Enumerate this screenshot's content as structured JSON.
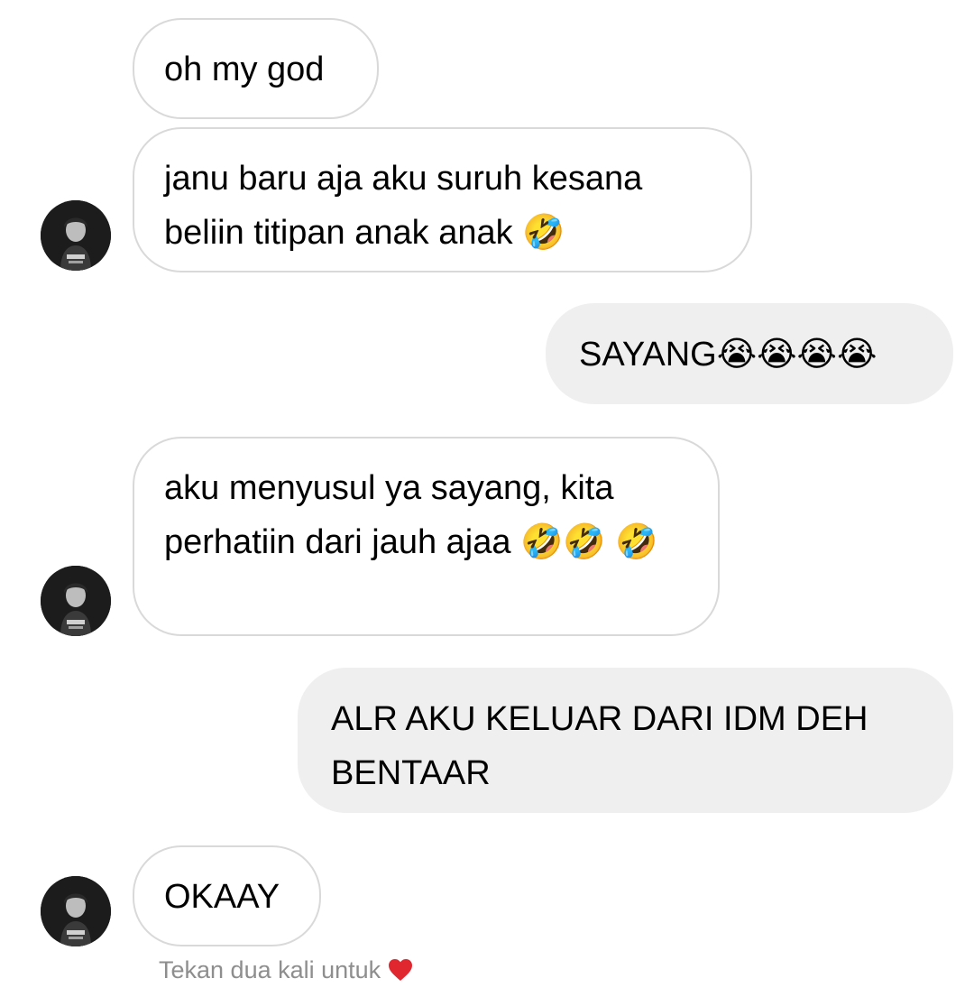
{
  "conversation": {
    "messages": [
      {
        "direction": "incoming",
        "text": "oh my god"
      },
      {
        "direction": "incoming",
        "text": "janu baru aja aku suruh kesana beliin titipan anak anak 🤣"
      },
      {
        "direction": "outgoing",
        "text": "SAYANG😭😭😭😭"
      },
      {
        "direction": "incoming",
        "text": "aku menyusul ya sayang, kita perhatiin dari jauh ajaa 🤣🤣 🤣"
      },
      {
        "direction": "outgoing",
        "text": "ALR AKU KELUAR DARI IDM DEH BENTAAR"
      },
      {
        "direction": "incoming",
        "text": "OKAAY"
      }
    ],
    "hint": {
      "text": "Tekan dua kali untuk",
      "icon": "heart-icon"
    },
    "avatar_icon": "profile-avatar-icon"
  },
  "colors": {
    "incoming_bubble_border": "#d9d9d9",
    "outgoing_bubble_bg": "#efefef",
    "hint_text": "#8e8e8e",
    "heart": "#e0262f"
  }
}
